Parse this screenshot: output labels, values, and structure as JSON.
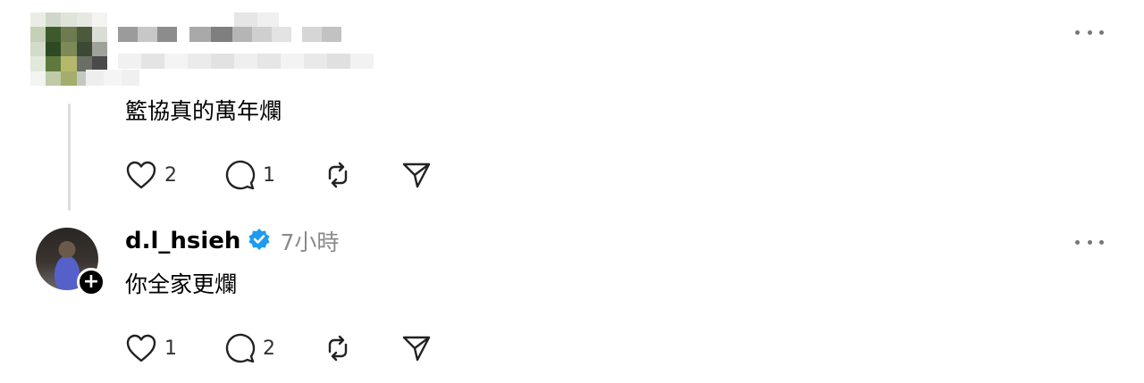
{
  "comments": [
    {
      "text": "籃協真的萬年爛",
      "likes": "2",
      "replies": "1"
    },
    {
      "username": "d.l_hsieh",
      "time": "7小時",
      "text": "你全家更爛",
      "likes": "1",
      "replies": "2"
    }
  ],
  "icons": {
    "like": "heart-icon",
    "reply": "comment-icon",
    "repost": "repost-icon",
    "share": "send-icon",
    "more": "more-horizontal-icon",
    "verified": "verified-badge-icon",
    "follow": "plus-icon"
  },
  "colors": {
    "verified": "#1d9bf0",
    "muted": "#8a8a8a",
    "divider": "#dcdcdc"
  }
}
